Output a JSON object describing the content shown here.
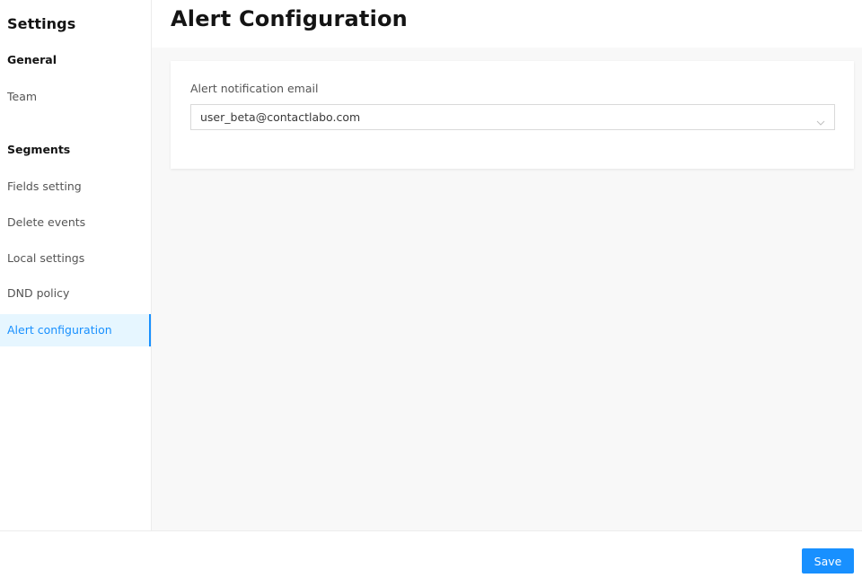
{
  "sidebar": {
    "title": "Settings",
    "sections": [
      {
        "heading": "General",
        "items": [
          {
            "label": "Team",
            "active": false
          }
        ]
      },
      {
        "heading": "Segments",
        "items": [
          {
            "label": "Fields setting",
            "active": false
          },
          {
            "label": "Delete events",
            "active": false
          },
          {
            "label": "Local settings",
            "active": false
          },
          {
            "label": "DND policy",
            "active": false
          },
          {
            "label": "Alert configuration",
            "active": true
          }
        ]
      }
    ]
  },
  "header": {
    "title": "Alert Configuration"
  },
  "form": {
    "email_label": "Alert notification email",
    "email_value": "user_beta@contactlabo.com",
    "email_icon": "chevron-down-icon"
  },
  "footer": {
    "save_label": "Save"
  },
  "colors": {
    "accent": "#1890ff",
    "active_bg": "#e6f6ff",
    "content_bg": "#f8f8f8"
  }
}
